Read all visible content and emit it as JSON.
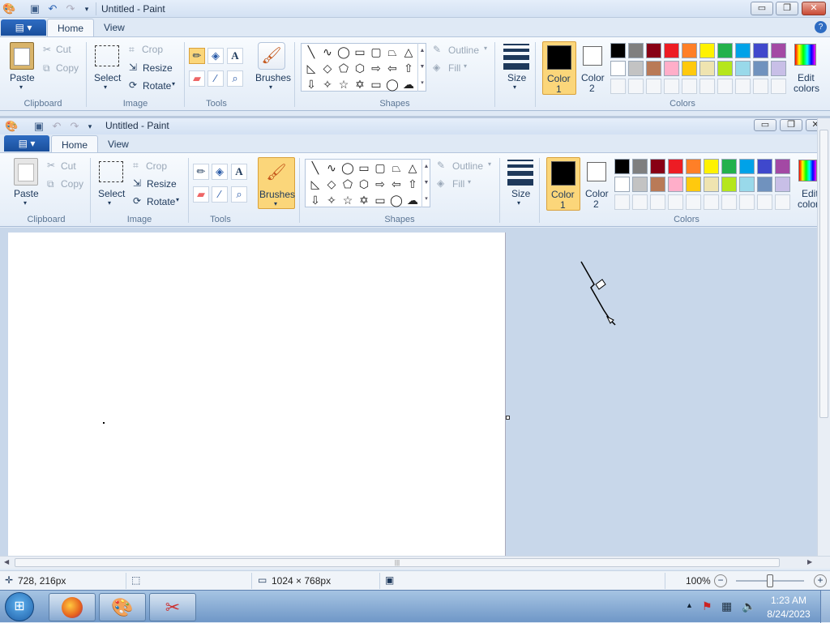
{
  "outer": {
    "title": "Untitled - Paint",
    "tabs": [
      "Home",
      "View"
    ],
    "window_buttons": [
      "▭",
      "❐",
      "✕"
    ],
    "help": "?"
  },
  "inner": {
    "title": "Untitled - Paint",
    "tabs": [
      "Home",
      "View"
    ],
    "window_buttons": [
      "▭",
      "❐",
      "✕"
    ]
  },
  "ribbon": {
    "clipboard": {
      "paste": "Paste",
      "cut": "Cut",
      "copy": "Copy",
      "group": "Clipboard"
    },
    "image": {
      "select": "Select",
      "crop": "Crop",
      "resize": "Resize",
      "rotate": "Rotate",
      "group": "Image"
    },
    "tools": {
      "group": "Tools"
    },
    "brushes": {
      "label": "Brushes"
    },
    "shapes": {
      "outline": "Outline",
      "fill": "Fill",
      "group": "Shapes"
    },
    "size": {
      "label": "Size"
    },
    "colors": {
      "color1": "Color",
      "color1_num": "1",
      "color2": "Color",
      "color2_num": "2",
      "edit": "Edit",
      "edit2": "colors",
      "group": "Colors",
      "row1": [
        "#000000",
        "#7f7f7f",
        "#880015",
        "#ed1c24",
        "#ff7f27",
        "#fff200",
        "#22b14c",
        "#00a2e8",
        "#3f48cc",
        "#a349a4"
      ],
      "row2": [
        "#ffffff",
        "#c3c3c3",
        "#b97a57",
        "#ffaec9",
        "#ffc90e",
        "#efe4b0",
        "#b5e61d",
        "#99d9ea",
        "#7092be",
        "#c8bfe7"
      ]
    }
  },
  "status": {
    "cursor_pos": "728, 216px",
    "canvas_size": "1024 × 768px",
    "zoom": "100%"
  },
  "taskbar": {
    "time": "1:23 AM",
    "date": "8/24/2023"
  },
  "icons": {
    "undo": "↶",
    "redo": "↷",
    "save": "💾",
    "dropdown": "▾",
    "cut": "✂",
    "pencil": "✏",
    "fill": "🪣",
    "text": "A",
    "eraser": "▭",
    "picker": "⁄",
    "magnifier": "🔍"
  }
}
